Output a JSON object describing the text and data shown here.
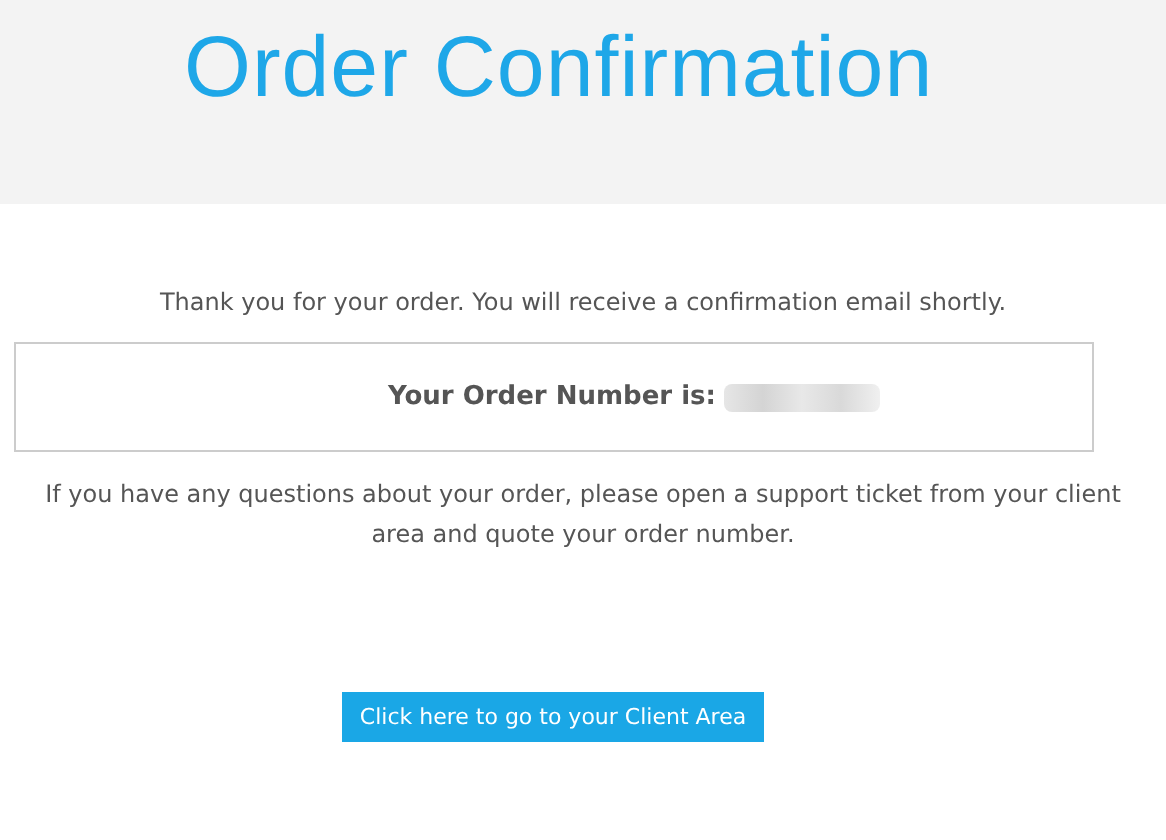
{
  "header": {
    "title": "Order Confirmation"
  },
  "message": "Thank you for your order. You will receive a confirmation email shortly.",
  "order_box": {
    "label": "Your Order Number is:",
    "number_redacted": true
  },
  "help_text": "If you have any questions about your order, please open a support ticket from your client area and quote your order number.",
  "button": {
    "label": "Click here to go to your Client Area"
  }
}
